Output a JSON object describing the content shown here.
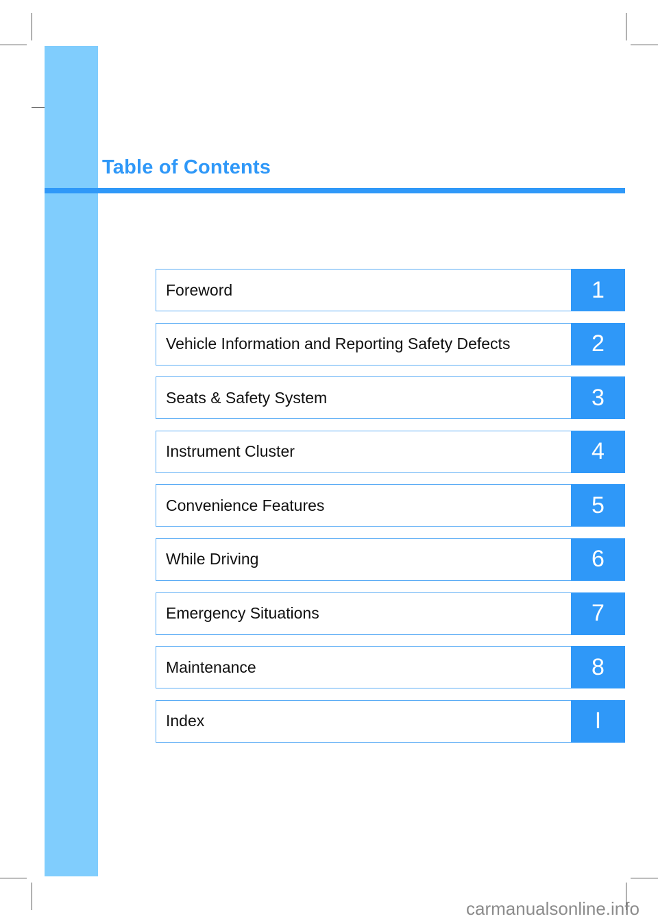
{
  "page": {
    "title": "Table of Contents",
    "accent_color": "#2f98f8",
    "band_color": "#80cdfd"
  },
  "toc": {
    "items": [
      {
        "label": "Foreword",
        "number": "1"
      },
      {
        "label": "Vehicle Information and Reporting Safety Defects",
        "number": "2"
      },
      {
        "label": "Seats & Safety System",
        "number": "3"
      },
      {
        "label": "Instrument Cluster",
        "number": "4"
      },
      {
        "label": "Convenience Features",
        "number": "5"
      },
      {
        "label": "While Driving",
        "number": "6"
      },
      {
        "label": "Emergency Situations",
        "number": "7"
      },
      {
        "label": "Maintenance",
        "number": "8"
      },
      {
        "label": "Index",
        "number": "I"
      }
    ]
  },
  "watermark": "carmanualsonline.info"
}
